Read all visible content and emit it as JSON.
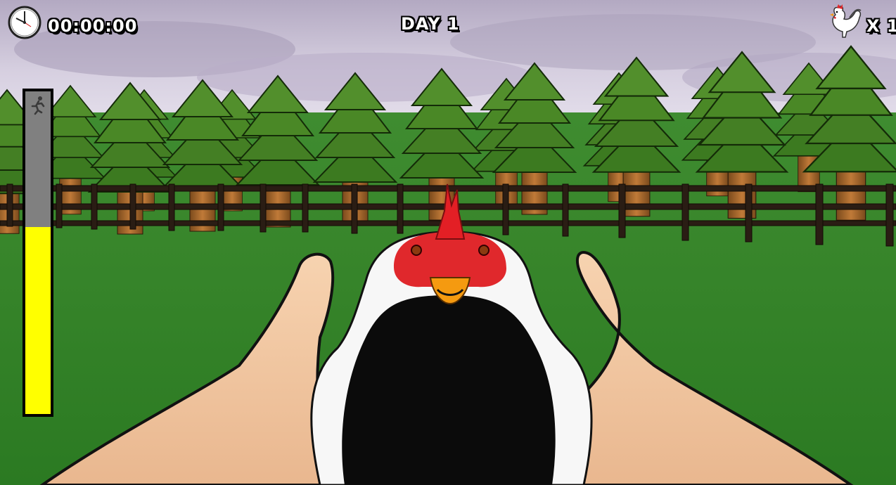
{
  "hud": {
    "timer": "00:00:00",
    "day": "DAY 1",
    "chicken_count": "X 1",
    "clock_icon": "clock-icon",
    "rooster_icon": "rooster-icon",
    "run_icon": "running-man-icon",
    "stamina_fraction": 0.58,
    "stamina_color": "#ffff00",
    "stamina_empty_color": "#808080"
  },
  "scene": {
    "sky_color": "#c9c0d6",
    "grass_color": "#2f7d25",
    "tree_color": "#3f7f22",
    "fence_color": "#2a1d14",
    "chicken_colors": [
      "#ffffff",
      "#0a0a0a",
      "#e0262a",
      "#f08a10"
    ],
    "hand_color": "#f2c6a0"
  }
}
